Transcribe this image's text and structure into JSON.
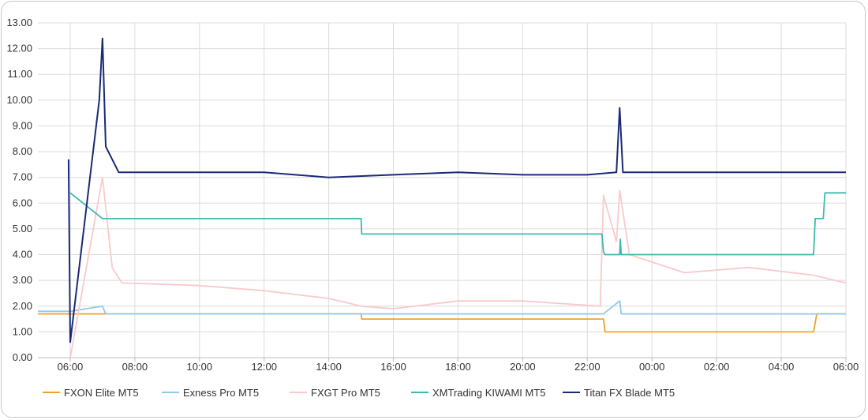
{
  "chart_data": {
    "type": "line",
    "title": "",
    "xlabel": "",
    "ylabel": "",
    "ylim": [
      0,
      13
    ],
    "y_ticks": [
      "0.00",
      "1.00",
      "2.00",
      "3.00",
      "4.00",
      "5.00",
      "6.00",
      "7.00",
      "8.00",
      "9.00",
      "10.00",
      "11.00",
      "12.00",
      "13.00"
    ],
    "x_ticks": [
      "06:00",
      "08:00",
      "10:00",
      "12:00",
      "14:00",
      "16:00",
      "18:00",
      "20:00",
      "22:00",
      "00:00",
      "02:00",
      "04:00",
      "06:00"
    ],
    "x_range_hours": [
      5,
      30
    ],
    "grid": true,
    "legend_position": "bottom",
    "series": [
      {
        "name": "FXON Elite MT5",
        "color": "#f5a02a",
        "points": [
          [
            5.0,
            1.7
          ],
          [
            6.0,
            1.7
          ],
          [
            7.0,
            1.7
          ],
          [
            15.0,
            1.7
          ],
          [
            15.02,
            1.5
          ],
          [
            22.5,
            1.5
          ],
          [
            22.55,
            1.0
          ],
          [
            29.0,
            1.0
          ],
          [
            29.1,
            1.7
          ],
          [
            30.0,
            1.7
          ]
        ]
      },
      {
        "name": "Exness Pro MT5",
        "color": "#8ecae6",
        "points": [
          [
            5.0,
            1.8
          ],
          [
            6.0,
            1.8
          ],
          [
            7.0,
            2.0
          ],
          [
            7.1,
            1.7
          ],
          [
            15.0,
            1.7
          ],
          [
            22.5,
            1.7
          ],
          [
            23.0,
            2.2
          ],
          [
            23.05,
            1.7
          ],
          [
            30.0,
            1.7
          ]
        ]
      },
      {
        "name": "FXGT Pro MT5",
        "color": "#f9caca",
        "points": [
          [
            6.0,
            0.0
          ],
          [
            7.0,
            7.0
          ],
          [
            7.3,
            3.5
          ],
          [
            7.6,
            2.9
          ],
          [
            10.0,
            2.8
          ],
          [
            12.0,
            2.6
          ],
          [
            14.0,
            2.3
          ],
          [
            15.0,
            2.0
          ],
          [
            16.0,
            1.9
          ],
          [
            18.0,
            2.2
          ],
          [
            20.0,
            2.2
          ],
          [
            22.4,
            2.0
          ],
          [
            22.5,
            6.3
          ],
          [
            22.9,
            4.5
          ],
          [
            23.0,
            6.5
          ],
          [
            23.3,
            4.0
          ],
          [
            25.0,
            3.3
          ],
          [
            27.0,
            3.5
          ],
          [
            29.0,
            3.2
          ],
          [
            30.0,
            2.9
          ]
        ]
      },
      {
        "name": "XMTrading KIWAMI MT5",
        "color": "#3dbab0",
        "points": [
          [
            6.0,
            6.4
          ],
          [
            7.0,
            5.4
          ],
          [
            15.0,
            5.4
          ],
          [
            15.02,
            4.8
          ],
          [
            22.45,
            4.8
          ],
          [
            22.5,
            4.1
          ],
          [
            22.55,
            4.0
          ],
          [
            23.0,
            4.0
          ],
          [
            23.02,
            4.6
          ],
          [
            23.05,
            4.0
          ],
          [
            29.0,
            4.0
          ],
          [
            29.05,
            5.4
          ],
          [
            29.3,
            5.4
          ],
          [
            29.35,
            6.4
          ],
          [
            30.0,
            6.4
          ]
        ]
      },
      {
        "name": "Titan FX Blade MT5",
        "color": "#1b2a78",
        "points": [
          [
            5.95,
            7.7
          ],
          [
            6.0,
            0.6
          ],
          [
            6.9,
            10.0
          ],
          [
            7.0,
            12.4
          ],
          [
            7.1,
            8.2
          ],
          [
            7.5,
            7.2
          ],
          [
            10.0,
            7.2
          ],
          [
            12.0,
            7.2
          ],
          [
            14.0,
            7.0
          ],
          [
            16.0,
            7.1
          ],
          [
            18.0,
            7.2
          ],
          [
            20.0,
            7.1
          ],
          [
            22.0,
            7.1
          ],
          [
            22.9,
            7.2
          ],
          [
            23.0,
            9.7
          ],
          [
            23.1,
            7.2
          ],
          [
            26.0,
            7.2
          ],
          [
            28.0,
            7.2
          ],
          [
            30.0,
            7.2
          ]
        ]
      }
    ]
  }
}
